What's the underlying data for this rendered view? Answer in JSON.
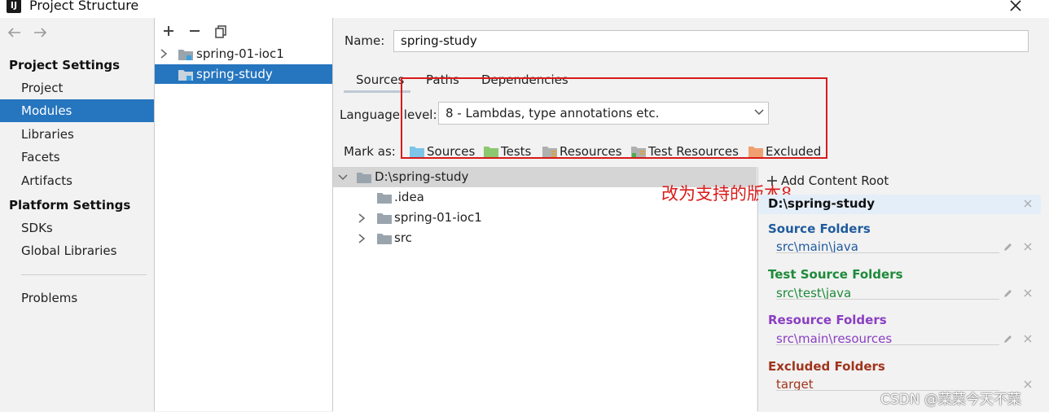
{
  "window": {
    "title": "Project Structure",
    "app_icon_text": "IJ"
  },
  "left_nav": {
    "sections": [
      {
        "title": "Project Settings",
        "items": [
          "Project",
          "Modules",
          "Libraries",
          "Facets",
          "Artifacts"
        ]
      },
      {
        "title": "Platform Settings",
        "items": [
          "SDKs",
          "Global Libraries"
        ]
      }
    ],
    "extra_item": "Problems",
    "selected": "Modules"
  },
  "modules": {
    "toolbar": [
      "add-icon",
      "remove-icon",
      "copy-icon"
    ],
    "items": [
      {
        "label": "spring-01-ioc1",
        "expandable": true,
        "selected": false
      },
      {
        "label": "spring-study",
        "expandable": false,
        "selected": true
      }
    ]
  },
  "main": {
    "name_label": "Name:",
    "name_value": "spring-study",
    "tabs": [
      "Sources",
      "Paths",
      "Dependencies"
    ],
    "active_tab": "Sources",
    "language_label": "Language level:",
    "language_value": "8 - Lambdas, type annotations etc.",
    "mark_as_label": "Mark as:",
    "mark_as": [
      {
        "label": "Sources",
        "color": "#7cc4e8"
      },
      {
        "label": "Tests",
        "color": "#8cc870"
      },
      {
        "label": "Resources",
        "color": "#b0b0b0"
      },
      {
        "label": "Test Resources",
        "color": "#b0b0b0"
      },
      {
        "label": "Excluded",
        "color": "#f0a070"
      }
    ]
  },
  "tree": {
    "root": "D:\\spring-study",
    "children": [
      {
        "label": ".idea",
        "expandable": false
      },
      {
        "label": "spring-01-ioc1",
        "expandable": true
      },
      {
        "label": "src",
        "expandable": true
      }
    ]
  },
  "annotation": "改为支持的版本8",
  "content_roots": {
    "add_label": "Add Content Root",
    "root": "D:\\spring-study",
    "groups": [
      {
        "title": "Source Folders",
        "path": "src\\main\\java",
        "color": "#1f5b9e"
      },
      {
        "title": "Test Source Folders",
        "path": "src\\test\\java",
        "color": "#1e8a3a"
      },
      {
        "title": "Resource Folders",
        "path": "src\\main\\resources",
        "color": "#8a3ec2"
      },
      {
        "title": "Excluded Folders",
        "path": "target",
        "color": "#a0341c"
      }
    ]
  },
  "watermark": "CSDN @菜菜今天不菜",
  "colors": {
    "selection": "#2675bf",
    "highlight": "#d91a1a",
    "folder": "#9aa4ad"
  }
}
